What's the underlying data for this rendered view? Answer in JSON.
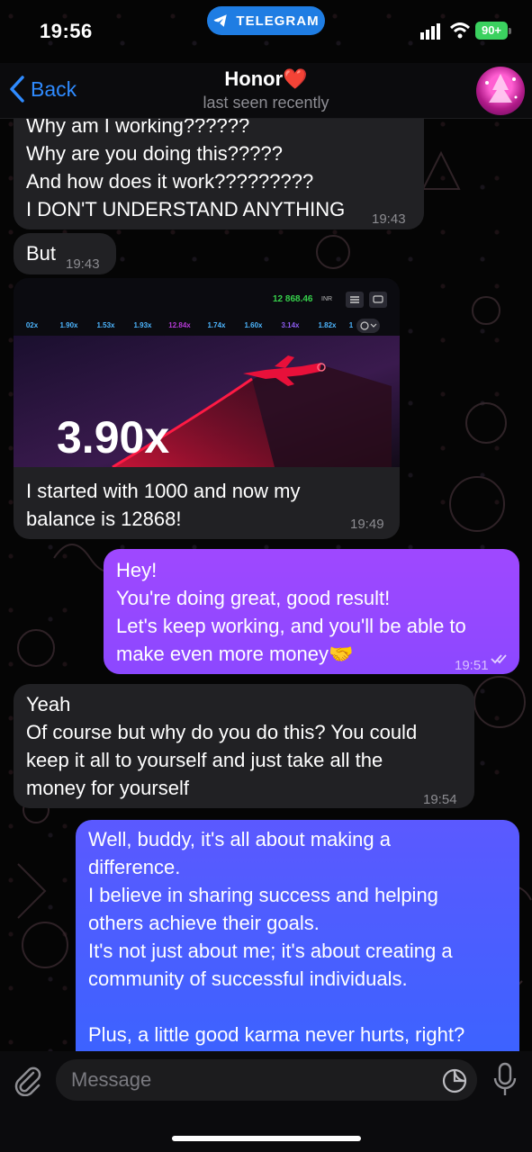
{
  "status_bar": {
    "time": "19:56",
    "app_pill": "TELEGRAM",
    "battery": "90+"
  },
  "header": {
    "back_label": "Back",
    "contact_name": "Honor❤️",
    "contact_status": "last seen recently"
  },
  "messages": [
    {
      "direction": "incoming",
      "lines": [
        "Why am I working??????",
        "Why are you doing this?????",
        "And how does it work?????????",
        "I DON'T UNDERSTAND ANYTHING"
      ],
      "time": "19:43"
    },
    {
      "direction": "incoming",
      "lines": [
        "But"
      ],
      "time": "19:43"
    },
    {
      "direction": "incoming",
      "media": {
        "balance": "12 868.46",
        "currency": "INR",
        "multipliers": [
          "02x",
          "1.90x",
          "1.53x",
          "1.93x",
          "12.84x",
          "1.74x",
          "1.60x",
          "3.14x",
          "1.82x",
          "1"
        ],
        "current_multiplier": "3.90x"
      },
      "lines": [
        "I started with 1000 and now my",
        "balance is 12868!"
      ],
      "time": "19:49"
    },
    {
      "direction": "outgoing",
      "lines": [
        "Hey!",
        "You're doing great, good result!",
        "Let's keep working, and you'll be able to",
        "make even more money🤝"
      ],
      "time": "19:51"
    },
    {
      "direction": "incoming",
      "lines": [
        "Yeah",
        "Of course but why do you do this? You could",
        "keep it all to yourself and just take all the",
        "money for yourself"
      ],
      "time": "19:54"
    },
    {
      "direction": "outgoing",
      "lines": [
        "Well, buddy, it's all about making a",
        "difference.",
        "I believe in sharing success and helping",
        "others achieve their goals.",
        "It's not just about me; it's about creating a",
        "community of successful individuals.",
        "",
        "Plus, a little good karma never hurts, right?"
      ],
      "time": ""
    }
  ],
  "input": {
    "placeholder": "Message"
  },
  "icons": {
    "back": "chevron-left-icon",
    "attach": "paperclip-icon",
    "sticker": "sticker-icon",
    "mic": "microphone-icon",
    "read": "double-check-icon",
    "telegram": "telegram-plane-icon"
  },
  "colors": {
    "accent": "#2f8bff",
    "incoming_bubble": "#212124",
    "outgoing_bubble_1": "#9f48ff",
    "outgoing_bubble_2": "#4a5eff",
    "telegram_pill": "#1f7de3"
  }
}
